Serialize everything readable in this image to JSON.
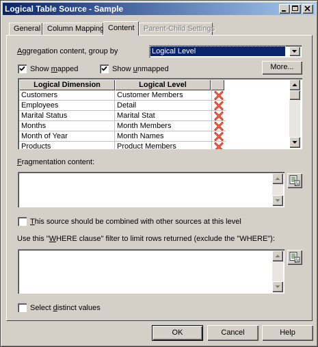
{
  "window": {
    "title": "Logical Table Source - Sample"
  },
  "tabs": [
    {
      "label": "General",
      "state": "normal"
    },
    {
      "label": "Column Mapping",
      "state": "normal"
    },
    {
      "label": "Content",
      "state": "active"
    },
    {
      "label": "Parent-Child Settings",
      "state": "disabled"
    }
  ],
  "aggregation": {
    "label_pre": "",
    "label_u": "A",
    "label_post": "ggregation content, group by",
    "selected": "Logical Level"
  },
  "options": {
    "show_mapped": {
      "pre": "Show ",
      "u": "m",
      "post": "apped",
      "checked": true
    },
    "show_unmapped": {
      "pre": "Show ",
      "u": "u",
      "post": "nmapped",
      "checked": true
    },
    "more_label": "More..."
  },
  "grid": {
    "columns": [
      "Logical Dimension",
      "Logical Level"
    ],
    "rows": [
      {
        "dimension": "Customers",
        "level": "Customer Members"
      },
      {
        "dimension": "Employees",
        "level": "Detail"
      },
      {
        "dimension": "Marital Status",
        "level": "Marital Stat"
      },
      {
        "dimension": "Months",
        "level": "Month Members"
      },
      {
        "dimension": "Month of Year",
        "level": "Month Names"
      },
      {
        "dimension": "Products",
        "level": "Product Members"
      }
    ],
    "delete_icon": "red-x-delete-icon"
  },
  "fragmentation": {
    "pre": "",
    "u": "F",
    "post": "ragmentation content:",
    "value": ""
  },
  "combine": {
    "pre": "",
    "u": "T",
    "post": "his source should be combined with other sources at this level",
    "checked": false
  },
  "where": {
    "pre": "Use this \"",
    "u": "W",
    "post": "HERE clause\" filter to limit rows returned (exclude the \"WHERE\"):",
    "value": ""
  },
  "distinct": {
    "pre": "Select ",
    "u": "d",
    "post": "istinct values",
    "checked": false
  },
  "buttons": {
    "ok": "OK",
    "cancel": "Cancel",
    "help": "Help"
  },
  "colors": {
    "title_start": "#0a246a",
    "title_end": "#a6caf0",
    "face": "#d4d0c8",
    "delete_red": "#d02010"
  }
}
